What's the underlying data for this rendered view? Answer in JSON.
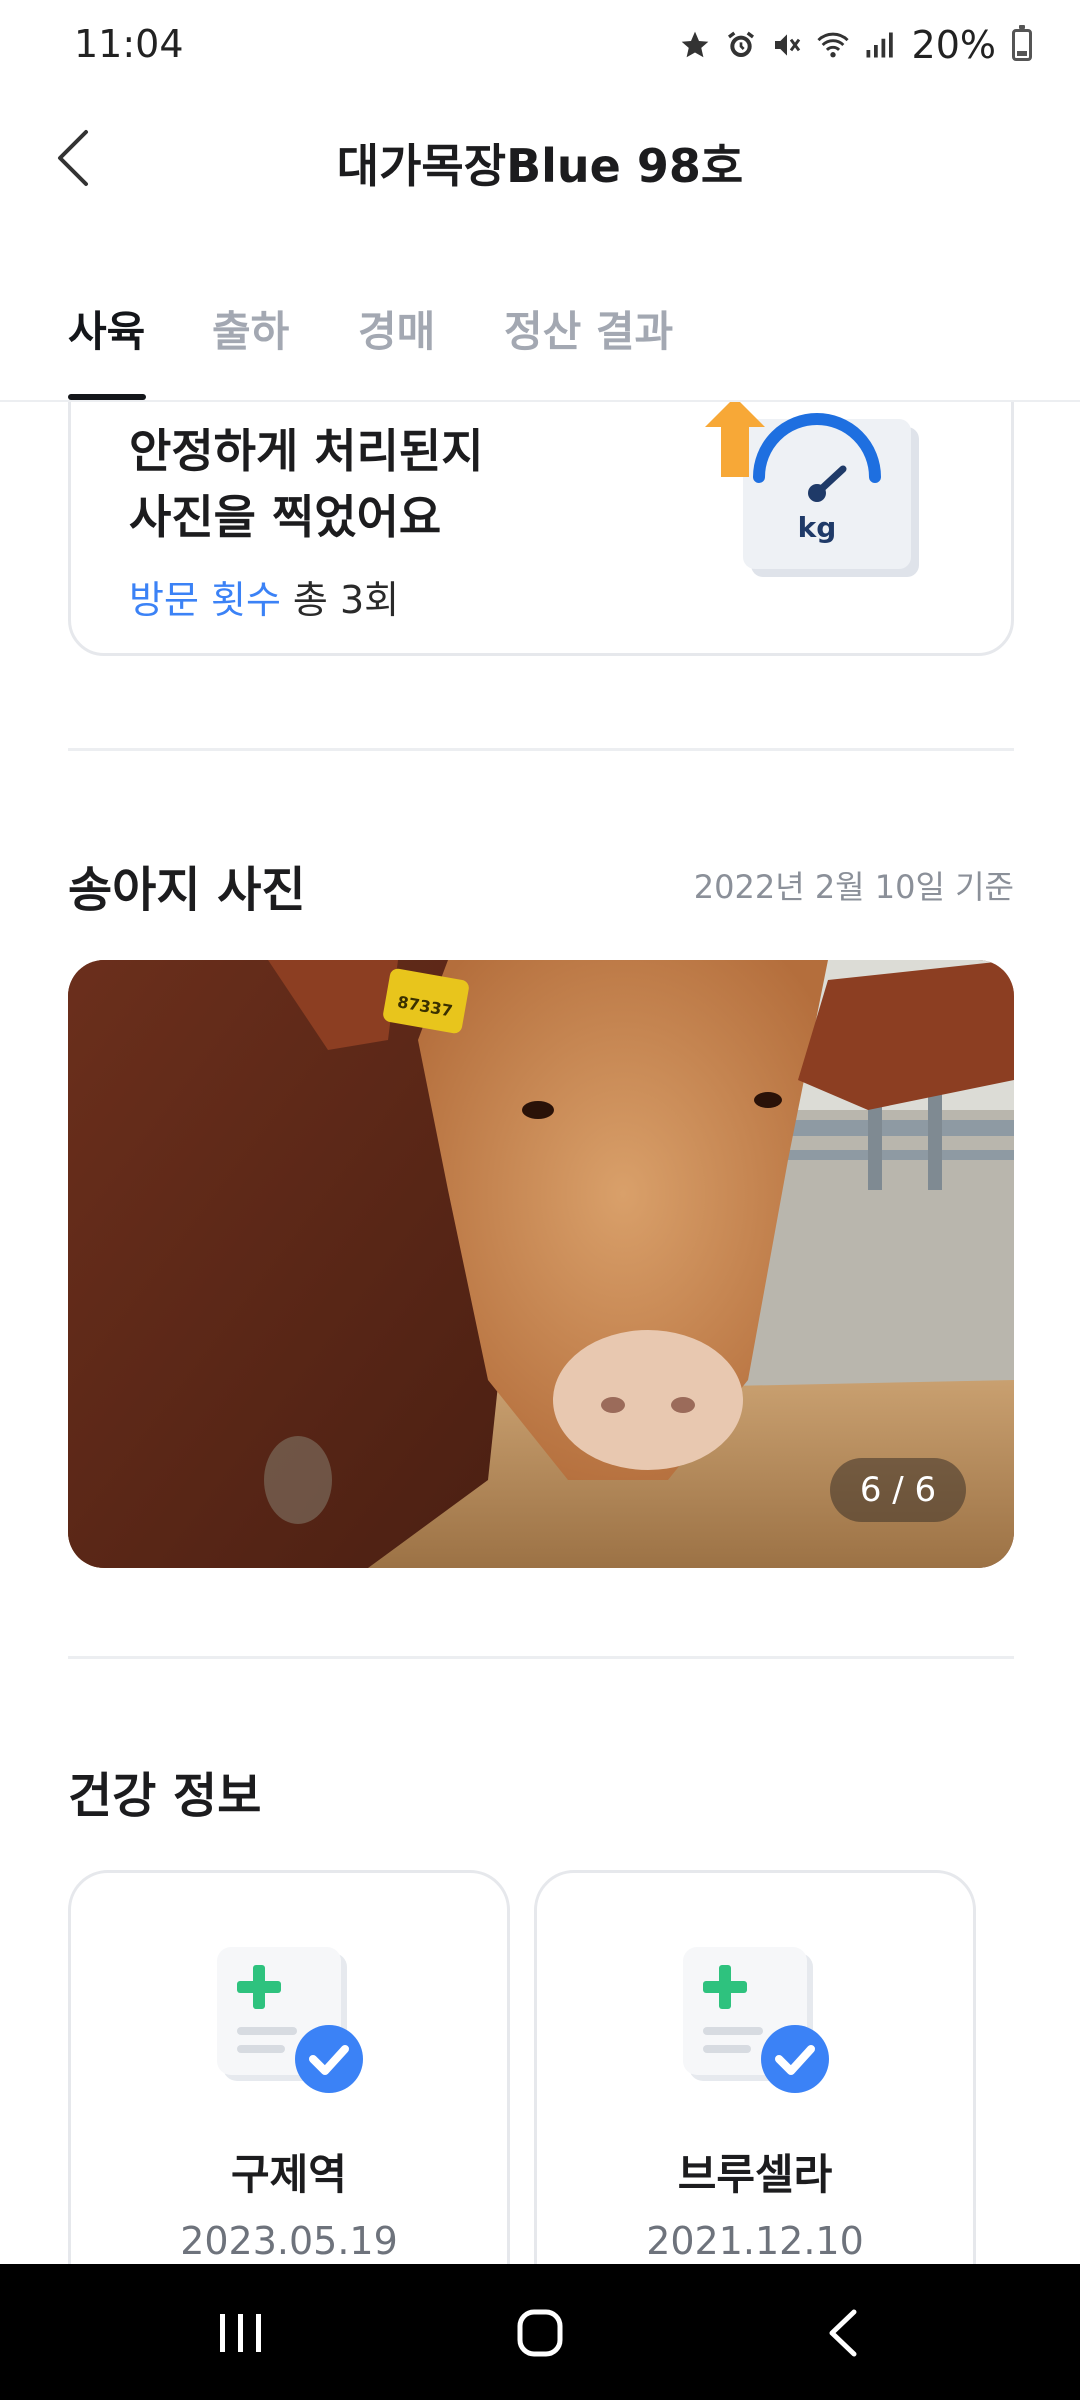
{
  "status_bar": {
    "time": "11:04",
    "battery_percent": "20%",
    "icons": [
      "star-icon",
      "alarm-icon",
      "mute-icon",
      "wifi-icon",
      "signal-icon",
      "battery-icon"
    ]
  },
  "header": {
    "title": "대가목장Blue 98호",
    "back_icon": "chevron-left-icon"
  },
  "tabs": [
    {
      "label": "사육",
      "active": true
    },
    {
      "label": "출하",
      "active": false
    },
    {
      "label": "경매",
      "active": false
    },
    {
      "label": "정산 결과",
      "active": false
    }
  ],
  "visit_card": {
    "line1": "안정하게 처리된지",
    "line2": "사진을 찍었어요",
    "count_label": "방문 횟수",
    "count_value": "총 3회",
    "illustration": "scale-kg-icon"
  },
  "photo_section": {
    "title": "송아지 사진",
    "date": "2022년 2월 10일 기준",
    "counter": "6 / 6",
    "ear_tag": "87337"
  },
  "health_section": {
    "title": "건강 정보",
    "cards": [
      {
        "name": "구제역",
        "date": "2023.05.19",
        "icon": "medical-record-check-icon"
      },
      {
        "name": "브루셀라",
        "date": "2021.12.10",
        "icon": "medical-record-check-icon"
      }
    ]
  },
  "nav_bar": {
    "buttons": [
      "recent-apps-icon",
      "home-icon",
      "back-icon"
    ]
  },
  "colors": {
    "accent_blue": "#3b82f6",
    "tab_active": "#14161a",
    "tab_inactive": "#a3a8b2",
    "green_cross": "#2ec27e"
  }
}
